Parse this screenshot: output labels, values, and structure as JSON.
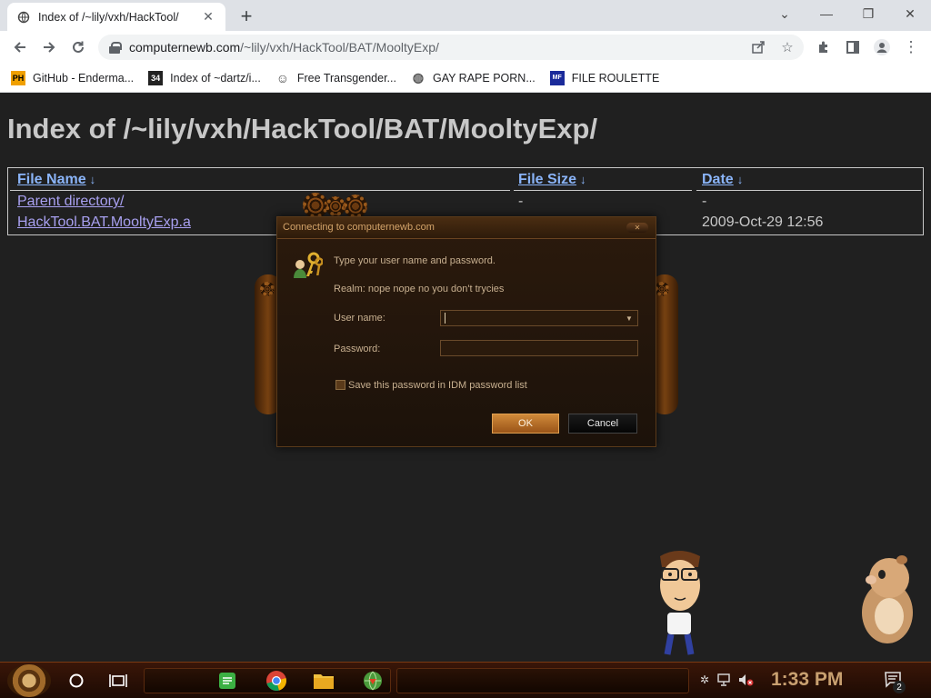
{
  "browser": {
    "tab": {
      "title": "Index of /~lily/vxh/HackTool/",
      "close": "✕"
    },
    "new_tab": "+",
    "window_controls": {
      "dropdown": "⌄",
      "minimize": "—",
      "restore": "❐",
      "close": "✕"
    },
    "url": {
      "host": "computernewb.com",
      "path": "/~lily/vxh/HackTool/BAT/MooltyExp/"
    },
    "bookmarks": [
      {
        "icon": "PH",
        "label": "GitHub - Enderma..."
      },
      {
        "icon": "34",
        "label": "Index of ~dartz/i..."
      },
      {
        "icon": "☺",
        "label": "Free Transgender..."
      },
      {
        "icon": "◍",
        "label": "GAY RAPE PORN..."
      },
      {
        "icon": "MF",
        "label": "FILE ROULETTE"
      }
    ]
  },
  "page": {
    "title": "Index of /~lily/vxh/HackTool/BAT/MooltyExp/",
    "columns": {
      "name": "File Name",
      "size": "File Size",
      "date": "Date",
      "sort_glyph": "↓"
    },
    "rows": [
      {
        "name": "Parent directory/",
        "size": "-",
        "date": "-"
      },
      {
        "name": "HackTool.BAT.MooltyExp.a",
        "size": "",
        "date": "2009-Oct-29 12:56"
      }
    ]
  },
  "dialog": {
    "title": "Connecting to computernewb.com",
    "prompt": "Type your user name and password.",
    "realm": "Realm: nope nope no you don't trycies",
    "username_label": "User name:",
    "username_value": "",
    "password_label": "Password:",
    "password_value": "",
    "save_label": "Save this password in IDM password list",
    "save_checked": false,
    "ok": "OK",
    "cancel": "Cancel"
  },
  "taskbar": {
    "clock": "1:33 PM",
    "notification_count": "2"
  },
  "colors": {
    "page_bg": "#202020",
    "link": "#8ab4f8",
    "dialog_bg": "#1c120a",
    "dialog_accent": "#d4a46a",
    "ok_button": "#c07a30",
    "clock": "#c8a070"
  }
}
